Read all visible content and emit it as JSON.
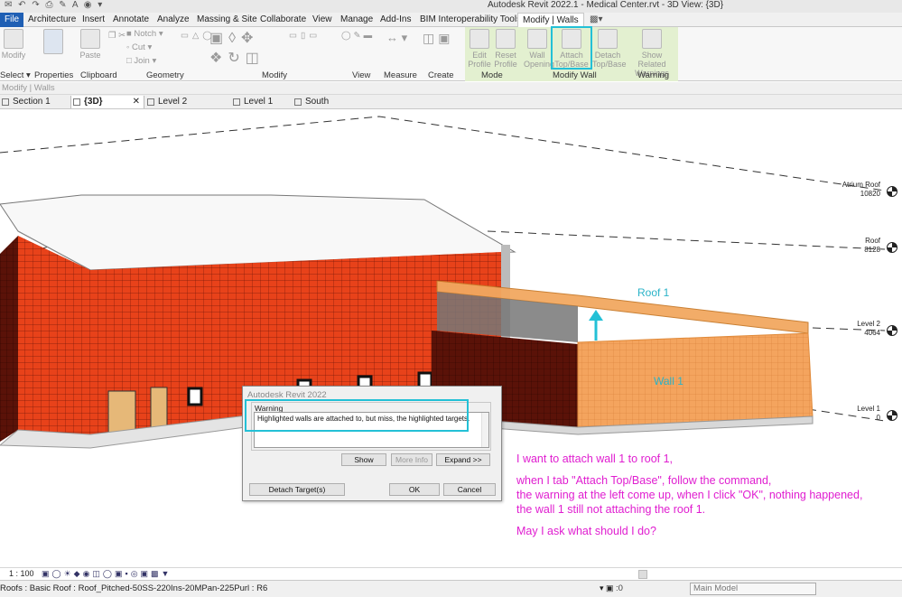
{
  "window": {
    "title": "Autodesk Revit 2022.1 - Medical Center.rvt - 3D View: {3D}"
  },
  "ribbon": {
    "tabs": [
      "File",
      "Architecture",
      "Insert",
      "Annotate",
      "Analyze",
      "Massing & Site",
      "Collaborate",
      "View",
      "Manage",
      "Add-Ins",
      "BIM Interoperability Tools",
      "Modify | Walls"
    ],
    "buttons": {
      "modify": "Modify",
      "select": "Select",
      "properties": "Properties",
      "paste": "Paste",
      "notch": "Notch",
      "cut": "Cut",
      "join": "Join",
      "edit_profile_1": "Edit",
      "edit_profile_2": "Profile",
      "reset_profile_1": "Reset",
      "reset_profile_2": "Profile",
      "wall_opening_1": "Wall",
      "wall_opening_2": "Opening",
      "attach_1": "Attach",
      "attach_2": "Top/Base",
      "detach_1": "Detach",
      "detach_2": "Top/Base",
      "show_warn_1": "Show Related",
      "show_warn_2": "Warnings"
    },
    "groups": {
      "select": "Select",
      "properties": "Properties",
      "clipboard": "Clipboard",
      "geometry": "Geometry",
      "modify": "Modify",
      "view": "View",
      "measure": "Measure",
      "create": "Create",
      "mode": "Mode",
      "modify_wall": "Modify Wall",
      "warning": "Warning"
    }
  },
  "options_bar": {
    "text": "Modify | Walls"
  },
  "view_tabs": [
    {
      "label": "Section 1"
    },
    {
      "label": "{3D}",
      "active": true
    },
    {
      "label": "Level 2"
    },
    {
      "label": "Level 1"
    },
    {
      "label": "South"
    }
  ],
  "levels": [
    {
      "name": "Atrium Roof",
      "elevation": "10820"
    },
    {
      "name": "Roof",
      "elevation": "8128"
    },
    {
      "name": "Level 2",
      "elevation": "4064"
    },
    {
      "name": "Level 1",
      "elevation": "0"
    }
  ],
  "annotations": {
    "roof": "Roof 1",
    "wall": "Wall 1"
  },
  "dialog": {
    "title": "Autodesk Revit 2022",
    "group": "Warning",
    "message": "Highlighted walls are attached to, but miss, the highlighted targets.",
    "show": "Show",
    "more_info": "More Info",
    "expand": "Expand >>",
    "detach": "Detach Target(s)",
    "ok": "OK",
    "cancel": "Cancel"
  },
  "question": [
    "I want to attach wall 1 to roof 1,",
    "",
    "when I tab \"Attach Top/Base\", follow the command,",
    "the warning at the left come up, when I click \"OK\", nothing happened,",
    "the wall 1 still not attaching the roof 1.",
    "",
    "May I ask what should I do?"
  ],
  "view_bar": {
    "scale": "1 : 100"
  },
  "status_bar": {
    "text": "Roofs : Basic Roof : Roof_Pitched-50SS-220Ins-20MPan-225Purl : R6",
    "worksets": ":0",
    "model": "Main Model"
  },
  "colors": {
    "accent_highlight": "#23c0d6",
    "brick": "#e8421a",
    "question_text": "#e01ed0",
    "file_tab": "#1f5fb4",
    "contextual_tab": "#e3f0d0"
  }
}
